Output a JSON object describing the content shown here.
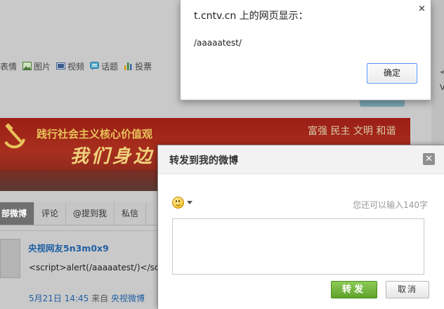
{
  "background_page": {
    "toolbar": {
      "items": [
        {
          "label": "表情",
          "icon": "emoticon-icon"
        },
        {
          "label": "图片",
          "icon": "image-icon"
        },
        {
          "label": "视频",
          "icon": "video-icon"
        },
        {
          "label": "话题",
          "icon": "topic-icon"
        },
        {
          "label": "投票",
          "icon": "poll-icon"
        }
      ]
    },
    "right_edge_chars": [
      "<",
      "V"
    ],
    "banner": {
      "slogan": "践行社会主义核心价值观",
      "values": "富强 民主 文明 和谐",
      "big_text": "我们身边"
    },
    "tabs": [
      {
        "label": "部微博",
        "active": true
      },
      {
        "label": "评论",
        "active": false
      },
      {
        "label": "@提到我",
        "active": false
      },
      {
        "label": "私信",
        "active": false
      }
    ],
    "post": {
      "username": "央视网友5n3m0x9",
      "content": "<script>alert(/aaaaatest/)</sc",
      "time": "5月21日 14:45",
      "from_label": "来自",
      "source": "央视微博"
    }
  },
  "repost_dialog": {
    "title": "转发到我的微博",
    "close_symbol": "✕",
    "char_hint": "您还可以输入140字",
    "text_value": "",
    "repost_button": "转发",
    "cancel_button": "取消"
  },
  "alert": {
    "title": "t.cntv.cn 上的网页显示：",
    "message": "/aaaaatest/",
    "ok_button": "确定",
    "close_symbol": "×"
  },
  "colors": {
    "link": "#1f5fa3",
    "repost_green": "#5fa32c",
    "alert_focus": "#4d90fe"
  }
}
